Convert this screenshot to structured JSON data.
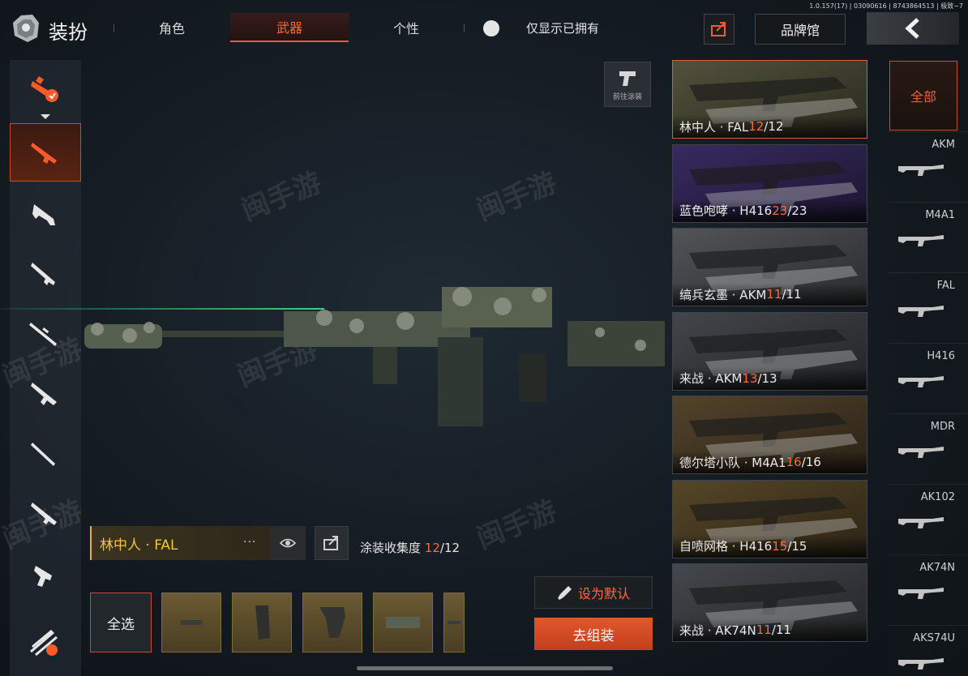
{
  "version_text": "1.0.157(17) | 03090616 | 8743864513 | 极致~7",
  "header": {
    "title": "装扮",
    "tabs": [
      {
        "label": "角色",
        "active": false
      },
      {
        "label": "武器",
        "active": true
      },
      {
        "label": "个性",
        "active": false
      }
    ],
    "owned_toggle_label": "仅显示已拥有",
    "brand_button": "品牌馆"
  },
  "left_categories": [
    {
      "icon": "all-weapons-icon",
      "active": false
    },
    {
      "icon": "assault-rifle-icon",
      "active": true
    },
    {
      "icon": "smg-icon",
      "active": false
    },
    {
      "icon": "shotgun-icon",
      "active": false
    },
    {
      "icon": "sniper-rifle-icon",
      "active": false
    },
    {
      "icon": "lmg-icon",
      "active": false
    },
    {
      "icon": "marksman-rifle-icon",
      "active": false
    },
    {
      "icon": "carbine-icon",
      "active": false
    },
    {
      "icon": "pistol-icon",
      "active": false
    },
    {
      "icon": "melee-icon",
      "active": false
    }
  ],
  "preview": {
    "goto_paint_label": "前往涂装",
    "skin_name": "林中人 · FAL",
    "more_dots": "···",
    "collection_label": "涂装收集度",
    "collection_owned": "12",
    "collection_total": "/12"
  },
  "parts": {
    "select_all": "全选",
    "count": 5
  },
  "actions": {
    "set_default": "设为默认",
    "assemble": "去组装"
  },
  "skins": [
    {
      "name": "林中人 · FAL ",
      "owned": "12",
      "total": "/12",
      "active": true,
      "tint": "#5a5a42"
    },
    {
      "name": "蓝色咆哮 · H416 ",
      "owned": "23",
      "total": "/23",
      "active": false,
      "tint": "#3d2f6a"
    },
    {
      "name": "缟兵玄墨 · AKM ",
      "owned": "11",
      "total": "/11",
      "active": false,
      "tint": "#5b5d61"
    },
    {
      "name": "来战 · AKM ",
      "owned": "13",
      "total": "/13",
      "active": false,
      "tint": "#4a4d52"
    },
    {
      "name": "德尔塔小队 · M4A1 ",
      "owned": "16",
      "total": "/16",
      "active": false,
      "tint": "#5c4a30"
    },
    {
      "name": "自喷网格 · H416 ",
      "owned": "15",
      "total": "/15",
      "active": false,
      "tint": "#5f4e2c"
    },
    {
      "name": "来战 · AK74N ",
      "owned": "11",
      "total": "/11",
      "active": false,
      "tint": "#4c4f54"
    }
  ],
  "filters": {
    "all_label": "全部",
    "items": [
      "AKM",
      "M4A1",
      "FAL",
      "H416",
      "MDR",
      "AK102",
      "AK74N",
      "AKS74U"
    ]
  },
  "colors": {
    "accent": "#ff5a2a",
    "gold": "#f0c542"
  }
}
